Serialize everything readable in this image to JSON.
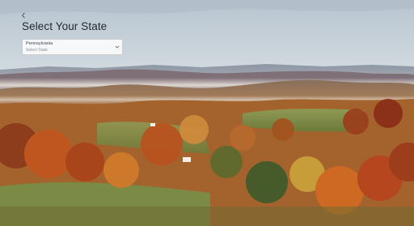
{
  "header": {
    "title": "Select Your State",
    "back_icon": "chevron-left-icon"
  },
  "state_select": {
    "value": "Pennsylvania",
    "label": "Select State",
    "icon": "chevron-down-icon"
  },
  "background": {
    "icon": "autumn-landscape-image"
  },
  "colors": {
    "title": "#1f2a33",
    "select_bg": "#f7f8fa",
    "select_border": "#c9ced4"
  }
}
